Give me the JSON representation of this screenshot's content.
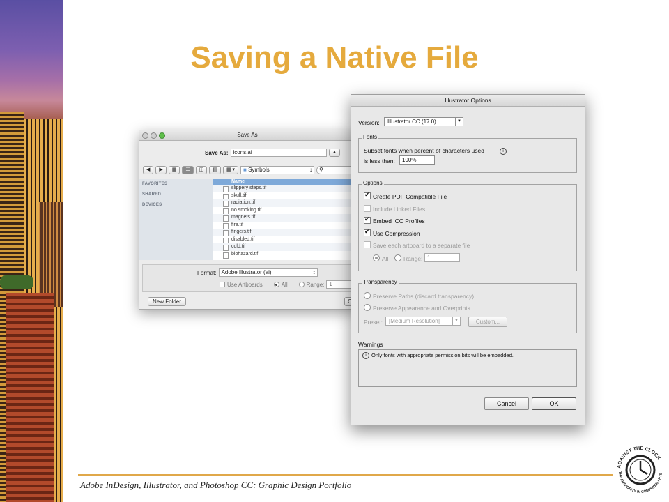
{
  "slide": {
    "title": "Saving a Native File",
    "footer": "Adobe InDesign, Illustrator, and Photoshop CC: Graphic Design Portfolio",
    "logo_text_top": "AGAINST THE CLOCK",
    "logo_text_bottom": "THE AUTHORITY IN COMPUTER ARTS"
  },
  "save_as": {
    "window_title": "Save As",
    "save_as_label": "Save As:",
    "filename": "icons.ai",
    "location": "Symbols",
    "sidebar": [
      "FAVORITES",
      "SHARED",
      "DEVICES"
    ],
    "column_header": "Name",
    "files": [
      "slippery steps.tif",
      "skull.tif",
      "radiation.tif",
      "no smoking.tif",
      "magnets.tif",
      "fire.tif",
      "fingers.tif",
      "disabled.tif",
      "cold.tif",
      "biohazard.tif"
    ],
    "format_label": "Format:",
    "format_value": "Adobe Illustrator (ai)",
    "use_artboards": "Use Artboards",
    "all_label": "All",
    "range_label": "Range:",
    "range_value": "1",
    "new_folder": "New Folder",
    "cancel_partial": "C"
  },
  "illustrator_options": {
    "window_title": "Illustrator Options",
    "version_label": "Version:",
    "version_value": "Illustrator CC (17.0)",
    "fonts": {
      "label": "Fonts",
      "subset_line1": "Subset fonts when percent of characters used",
      "subset_line2": "is less than:",
      "percent": "100%"
    },
    "options": {
      "label": "Options",
      "create_pdf": "Create PDF Compatible File",
      "include_linked": "Include Linked Files",
      "embed_icc": "Embed ICC Profiles",
      "use_compression": "Use Compression",
      "save_each": "Save each artboard to a separate file",
      "all": "All",
      "range": "Range:",
      "range_value": "1"
    },
    "transparency": {
      "label": "Transparency",
      "preserve_paths": "Preserve Paths (discard transparency)",
      "preserve_appearance": "Preserve Appearance and Overprints",
      "preset_label": "Preset:",
      "preset_value": "[Medium Resolution]",
      "custom": "Custom..."
    },
    "warnings": {
      "label": "Warnings",
      "text": "Only fonts with appropriate permission bits will be embedded."
    },
    "cancel": "Cancel",
    "ok": "OK"
  }
}
